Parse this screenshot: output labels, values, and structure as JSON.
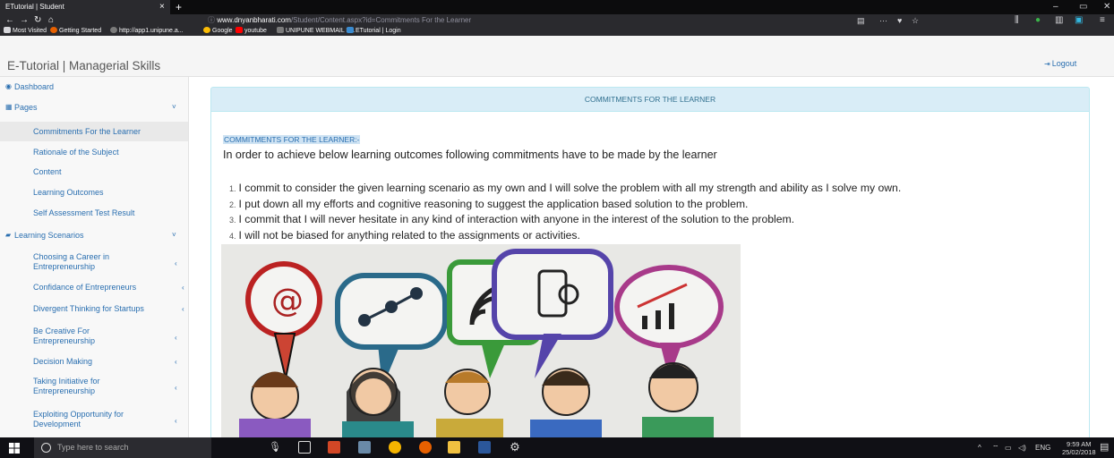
{
  "browser": {
    "tab_title": "ETutorial | Student",
    "tab_close": "×",
    "new_tab": "+",
    "win_min": "–",
    "win_max": "▭",
    "win_close": "✕",
    "url_host": "www.dnyanbharati.com",
    "url_path": "/Student/Content.aspx?id=Commitments For the Learner",
    "url_actions": "···",
    "bookmarks": [
      {
        "label": "Most Visited",
        "color": "#d7d7db"
      },
      {
        "label": "Getting Started",
        "color": "#e66000"
      },
      {
        "label": "http://app1.unipune.a...",
        "color": "#7a7a7a"
      },
      {
        "label": "Google",
        "color": "#fbbc05"
      },
      {
        "label": "youtube",
        "color": "#ff0000"
      },
      {
        "label": "UNIPUNE WEBMAIL L...",
        "color": "#7a7a7a"
      },
      {
        "label": "ETutorial | Login",
        "color": "#3a8bd0"
      }
    ]
  },
  "header": {
    "title": "E-Tutorial | Managerial Skills",
    "logout": "Logout"
  },
  "sidebar": {
    "dashboard": "Dashboard",
    "pages": "Pages",
    "pages_items": [
      "Commitments For the Learner",
      "Rationale of the Subject",
      "Content",
      "Learning Outcomes",
      "Self Assessment Test Result"
    ],
    "learning_scenarios": "Learning Scenarios",
    "scenario_items": [
      {
        "line1": "Choosing a Career in",
        "line2": "Entrepreneurship"
      },
      {
        "line1": "Confidance of Entrepreneurs",
        "line2": ""
      },
      {
        "line1": "Divergent Thinking for Startups",
        "line2": ""
      },
      {
        "line1": "Be Creative For",
        "line2": "Entrepreneurship"
      },
      {
        "line1": "Decision Making",
        "line2": ""
      },
      {
        "line1": "Taking Initiative for",
        "line2": "Entrepreneurship"
      },
      {
        "line1": "Exploiting Opportunity for",
        "line2": "Development"
      }
    ]
  },
  "main": {
    "panel_title": "COMMITMENTS FOR THE LEARNER",
    "subheading": "COMMITMENTS FOR THE LEARNER:-",
    "intro": "In order to achieve below learning outcomes following commitments have to be made by the learner",
    "commitments": [
      "I commit to consider the given learning scenario as my own and I will solve the problem with all my strength and ability as I solve my own.",
      "I put down all my efforts and cognitive reasoning to suggest the application based solution to the problem.",
      "I commit that I will never hesitate in any kind of interaction with anyone in the interest of the solution to the problem.",
      "I will not be biased for anything related to the assignments or activities."
    ],
    "illustration_bubble_text": "@"
  },
  "taskbar": {
    "search_placeholder": "Type here to search",
    "tray_lang": "ENG",
    "time": "9:59 AM",
    "date": "25/02/2018"
  }
}
